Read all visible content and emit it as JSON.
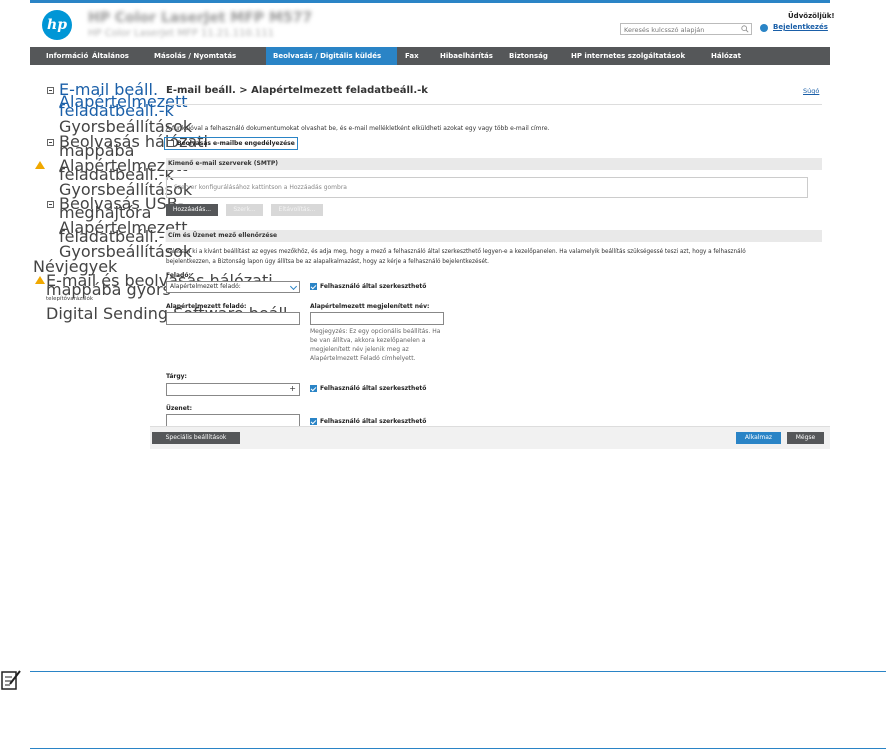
{
  "header": {
    "device_name": "HP Color LaserJet MFP M577",
    "device_subtitle": "HP Color LaserJet MFP   11.21.110.111",
    "search_placeholder": "Keresés kulcsszó alapján",
    "greeting": "Üdvözöljük!",
    "signin": "Bejelentkezés"
  },
  "nav": {
    "tabs": [
      "Információ",
      "Általános",
      "Másolás / Nyomtatás",
      "Beolvasás / Digitális küldés",
      "Fax",
      "Hibaelhárítás",
      "Biztonság",
      "HP internetes szolgáltatások",
      "Hálózat"
    ],
    "active": "Beolvasás / Digitális küldés"
  },
  "sidebar": {
    "email_setup": "E-mail beáll.",
    "default_job_opts_1": "Alapértelmezett",
    "default_job_opts_2": "feladatbeáll.-k",
    "quick_sets_1": "Gyorsbeállítások",
    "scan_to_folder_1": "Beolvasás hálózati",
    "scan_to_folder_2": "mappába",
    "default_job_opts_b1": "Alapértelmezett",
    "default_job_opts_b2": "feladatbeáll.-k",
    "quick_sets_2": "Gyorsbeállítások",
    "scan_to_usb_1": "Beolvasás USB-",
    "scan_to_usb_2": "meghajtóra",
    "default_job_opts_c1": "Alapértelmezett",
    "default_job_opts_c2": "feladatbeáll.-k",
    "quick_sets_3": "Gyorsbeállítások",
    "contacts": "Névjegyek",
    "email_folder_1": "E-mail és beolvasás hálózati",
    "email_folder_2": "mappába gyors",
    "email_folder_3": "telepítővarázslók",
    "dss": "Digital Sending Software beáll."
  },
  "main": {
    "title": "E-mail beáll. > Alapértelmezett feladatbeáll.-k",
    "help": "Súgó",
    "description": "A funkcióval a felhasználó dokumentumokat olvashat be, és e-mail mellékletként elküldheti azokat egy vagy több e-mail címre.",
    "enable_label": "Beolvasás e-mailbe engedélyezése",
    "smtp_section": "Kimenő e-mail szerverek (SMTP)",
    "smtp_placeholder": "Szerver konfigurálásához kattintson a Hozzáadás gombra",
    "add_button": "Hozzáadás...",
    "edit_button": "Szerk...",
    "remove_button": "Eltávolítás...",
    "address_section": "Cím és Üzenet mező ellenőrzése",
    "address_desc_1": "Válassza ki a kívánt beállítást az egyes mezőkhöz, és adja meg, hogy a mező a felhasználó által szerkeszthető legyen-e a kezelőpanelen. Ha valamelyik beállítás szükségessé teszi azt, hogy a felhasználó",
    "address_desc_2": "bejelentkezzen, a Biztonság lapon úgy állítsa be az alapalkalmazást, hogy az kérje a felhasználó bejelentkezését.",
    "from_label": "Feladó:",
    "from_value": "Alapértelmezett feladó:",
    "user_editable": "Felhasználó által szerkeszthető",
    "default_from_label": "Alapértelmezett feladó:",
    "default_display_label": "Alapértelmezett megjelenített név:",
    "note_1": "Megjegyzés: Ez egy opcionális beállítás. Ha",
    "note_2": "be van állítva, akkora kezelőpanelen a",
    "note_3": "megjelenített név jelenik meg az",
    "note_4": "Alapértelmezett Feladó címhelyett.",
    "subject_label": "Tárgy:",
    "message_label": "Üzenet:"
  },
  "footer": {
    "advanced": "Speciális beállítások",
    "apply": "Alkalmaz",
    "cancel": "Mégse"
  },
  "colors": {
    "accent": "#2a84c6",
    "nav_bg": "#555759",
    "warning": "#f0a800"
  }
}
